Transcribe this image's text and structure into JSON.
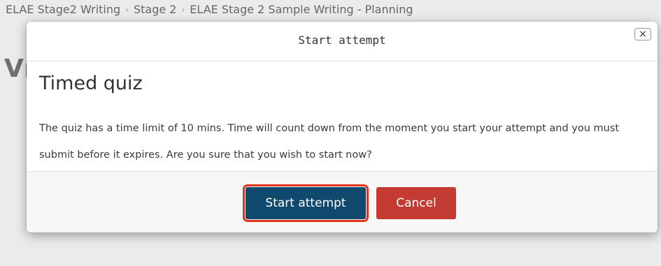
{
  "breadcrumb": {
    "items": [
      "ELAE Stage2 Writing",
      "Stage 2",
      "ELAE Stage 2 Sample Writing - Planning"
    ],
    "separator": "›"
  },
  "background": {
    "heading_fragment": "Vr"
  },
  "modal": {
    "title": "Start attempt",
    "close_icon": "×",
    "heading": "Timed quiz",
    "message": "The quiz has a time limit of 10 mins. Time will count down from the moment you start your attempt and you must submit before it expires. Are you sure that you wish to start now?",
    "buttons": {
      "start": "Start attempt",
      "cancel": "Cancel"
    }
  },
  "colors": {
    "primary": "#0f4a6e",
    "danger": "#c43b33",
    "highlight": "#e0321f"
  }
}
